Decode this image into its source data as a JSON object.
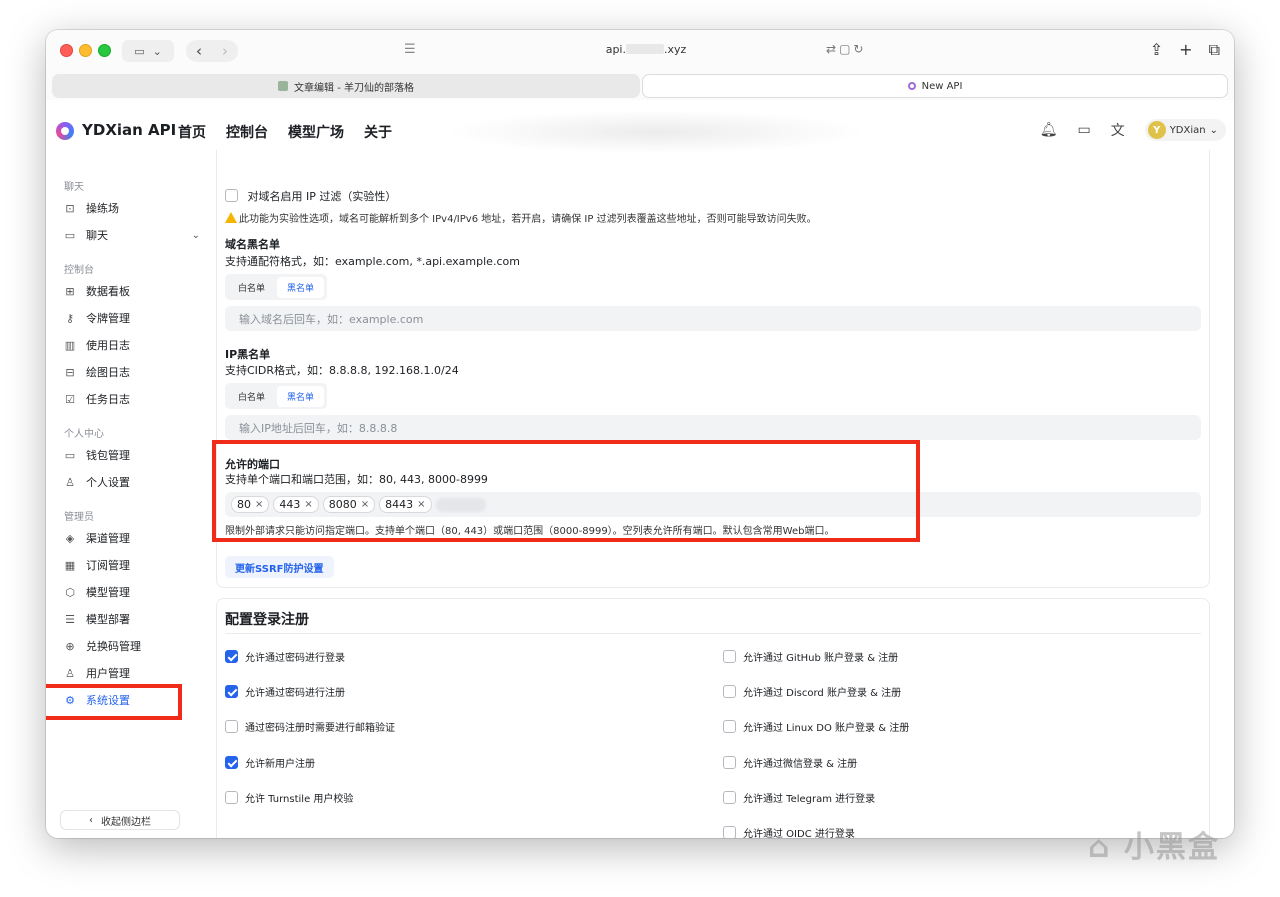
{
  "browser": {
    "address_prefix": "api.",
    "address_suffix": ".xyz",
    "tabs": [
      {
        "label": "文章编辑 - 羊刀仙的部落格"
      },
      {
        "label": "New API"
      }
    ]
  },
  "header": {
    "app_title": "YDXian API",
    "nav": [
      "首页",
      "控制台",
      "模型广场",
      "关于"
    ],
    "user": {
      "initial": "Y",
      "name": "YDXian"
    }
  },
  "sidebar": {
    "groups": {
      "chat": "聊天",
      "console": "控制台",
      "personal": "个人中心",
      "admin": "管理员"
    },
    "items": {
      "playground": "操练场",
      "chat": "聊天",
      "dashboard": "数据看板",
      "tokens": "令牌管理",
      "usage_log": "使用日志",
      "drawing_log": "绘图日志",
      "task_log": "任务日志",
      "wallet": "钱包管理",
      "personal_settings": "个人设置",
      "channels": "渠道管理",
      "subscriptions": "订阅管理",
      "models": "模型管理",
      "deployments": "模型部署",
      "redeem": "兑换码管理",
      "users": "用户管理",
      "system_settings": "系统设置"
    },
    "collapse_label": "收起侧边栏"
  },
  "ssrf": {
    "domain_ip_filter": {
      "label": "对域名启用 IP 过滤（实验性）",
      "checked": false
    },
    "warning": "此功能为实验性选项，域名可能解析到多个 IPv4/IPv6 地址，若开启，请确保 IP 过滤列表覆盖这些地址，否则可能导致访问失败。",
    "domain_list": {
      "title": "域名黑名单",
      "desc": "支持通配符格式，如：example.com, *.api.example.com",
      "seg": [
        "白名单",
        "黑名单"
      ],
      "placeholder": "输入域名后回车，如：example.com"
    },
    "ip_list": {
      "title": "IP黑名单",
      "desc": "支持CIDR格式，如：8.8.8.8, 192.168.1.0/24",
      "seg": [
        "白名单",
        "黑名单"
      ],
      "placeholder": "输入IP地址后回车，如：8.8.8.8"
    },
    "ports": {
      "title": "允许的端口",
      "desc": "支持单个端口和端口范围，如：80, 443, 8000-8999",
      "tags": [
        "80",
        "443",
        "8080",
        "8443"
      ],
      "remove_glyph": "×",
      "help": "限制外部请求只能访问指定端口。支持单个端口（80, 443）或端口范围（8000-8999）。空列表允许所有端口。默认包含常用Web端口。"
    },
    "update_button": "更新SSRF防护设置"
  },
  "login": {
    "title": "配置登录注册",
    "left": [
      {
        "label": "允许通过密码进行登录",
        "checked": true
      },
      {
        "label": "允许通过密码进行注册",
        "checked": true
      },
      {
        "label": "通过密码注册时需要进行邮箱验证",
        "checked": false
      },
      {
        "label": "允许新用户注册",
        "checked": true
      },
      {
        "label": "允许 Turnstile 用户校验",
        "checked": false
      }
    ],
    "right": [
      {
        "label": "允许通过 GitHub 账户登录 & 注册",
        "checked": false
      },
      {
        "label": "允许通过 Discord 账户登录 & 注册",
        "checked": false
      },
      {
        "label": "允许通过 Linux DO 账户登录 & 注册",
        "checked": false
      },
      {
        "label": "允许通过微信登录 & 注册",
        "checked": false
      },
      {
        "label": "允许通过 Telegram 进行登录",
        "checked": false
      },
      {
        "label": "允许通过 OIDC 进行登录",
        "checked": false
      }
    ]
  },
  "watermark": "小黑盒",
  "colors": {
    "accent": "#2563eb",
    "highlight": "#f02b1a",
    "warning": "#f5b400"
  }
}
